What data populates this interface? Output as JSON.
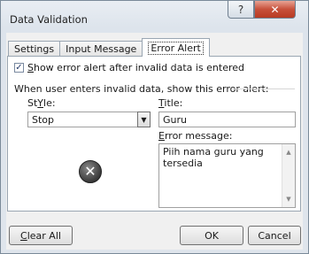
{
  "window": {
    "title": "Data Validation"
  },
  "titlebar": {
    "help_glyph": "?",
    "close_glyph": "✕"
  },
  "tabs": [
    {
      "label": "Settings"
    },
    {
      "label": "Input Message"
    },
    {
      "label": "Error Alert",
      "active": true
    }
  ],
  "error_alert": {
    "show_alert_checkbox": {
      "prefix": "S",
      "rest": "how error alert after invalid data is entered",
      "checked": true,
      "check_glyph": "✓"
    },
    "section_label": "When user enters invalid data, show this error alert:",
    "style_label": {
      "prefix": "Y",
      "rest": "",
      "pre": "St",
      "post": "le:"
    },
    "style_value": "Stop",
    "dropdown_glyph": "▼",
    "title_label": {
      "prefix": "T",
      "rest": "itle:"
    },
    "title_value": "Guru",
    "error_message_label": {
      "prefix": "E",
      "rest": "rror message:"
    },
    "error_message_value": "Piih nama guru yang tersedia",
    "scroll_up_glyph": "▲",
    "scroll_down_glyph": "▼",
    "stop_icon_glyph": "✕"
  },
  "footer": {
    "clear_all": {
      "prefix": "C",
      "rest": "lear All"
    },
    "ok_label": "OK",
    "cancel_label": "Cancel"
  }
}
